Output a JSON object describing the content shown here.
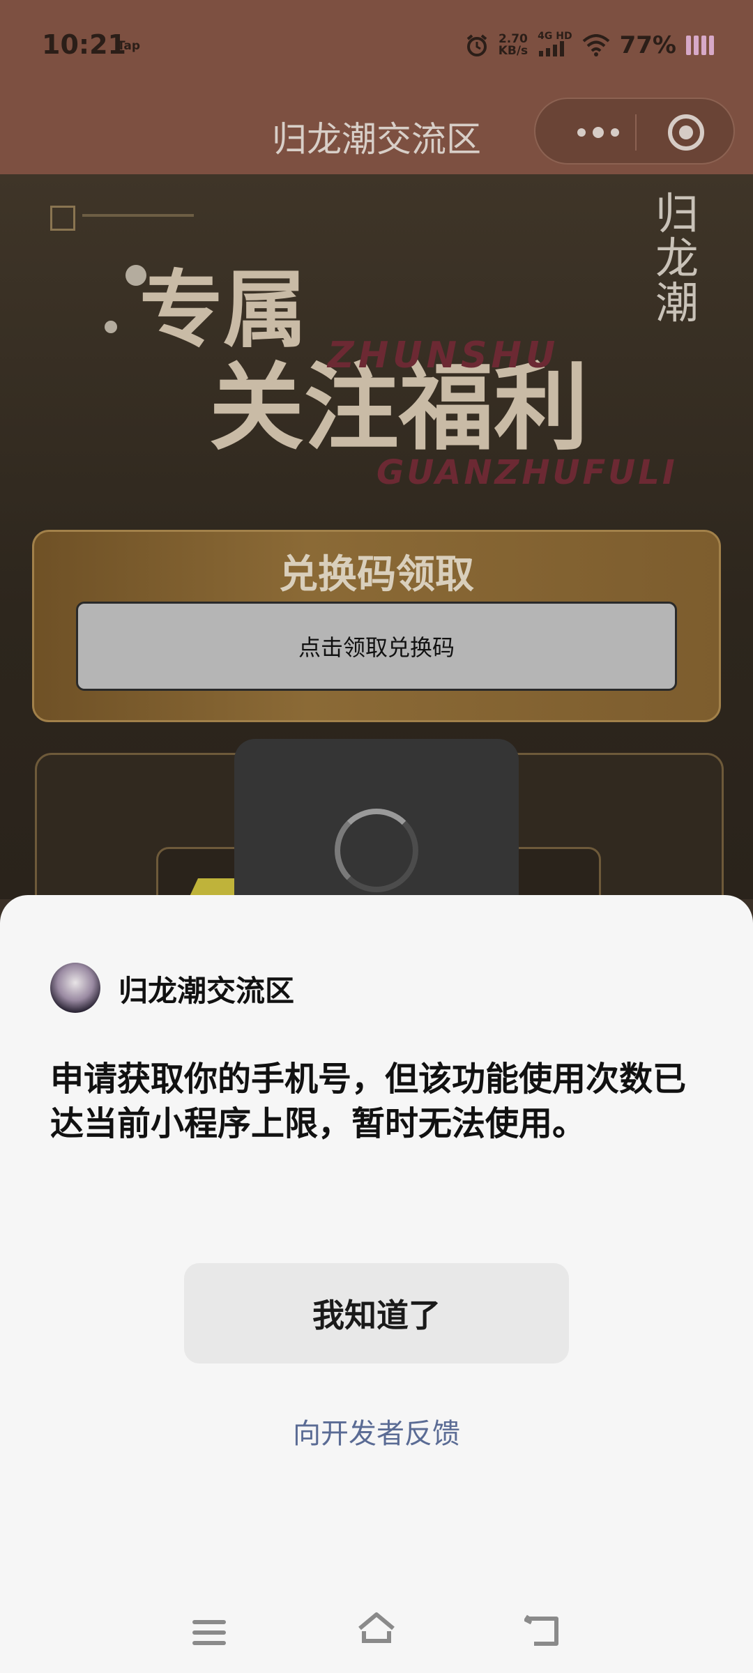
{
  "status_bar": {
    "time": "10:21",
    "tap": "Tap",
    "speed_value": "2.70",
    "speed_unit": "KB/s",
    "network_top": "4G HD",
    "network_bottom": "",
    "battery_percent": "77%",
    "icons": [
      "alarm-icon",
      "signal-icon",
      "wifi-icon",
      "battery-icon"
    ]
  },
  "title_bar": {
    "title": "归龙潮交流区",
    "capsule": [
      "more-icon",
      "close-miniprogram-icon"
    ]
  },
  "banner": {
    "logo_text": "归龙潮",
    "headline_line1": "专属",
    "headline_line2": "关注福利",
    "pinyin_line1": "ZHUNSHU",
    "pinyin_line2": "GUANZHUFULI",
    "redeem_title": "兑换码领取",
    "redeem_button": "点击领取兑换码"
  },
  "dialog": {
    "app_name": "归龙潮交流区",
    "message": "申请获取你的手机号，但该功能使用次数已达当前小程序上限，暂时无法使用。",
    "ok_button": "我知道了",
    "feedback_link": "向开发者反馈"
  },
  "nav_bar": {
    "icons": [
      "menu-icon",
      "home-icon",
      "back-icon"
    ]
  },
  "colors": {
    "sheet_bg": "#f6f6f6",
    "link": "#5a6b94",
    "header_dimmed": "#7d5041"
  }
}
